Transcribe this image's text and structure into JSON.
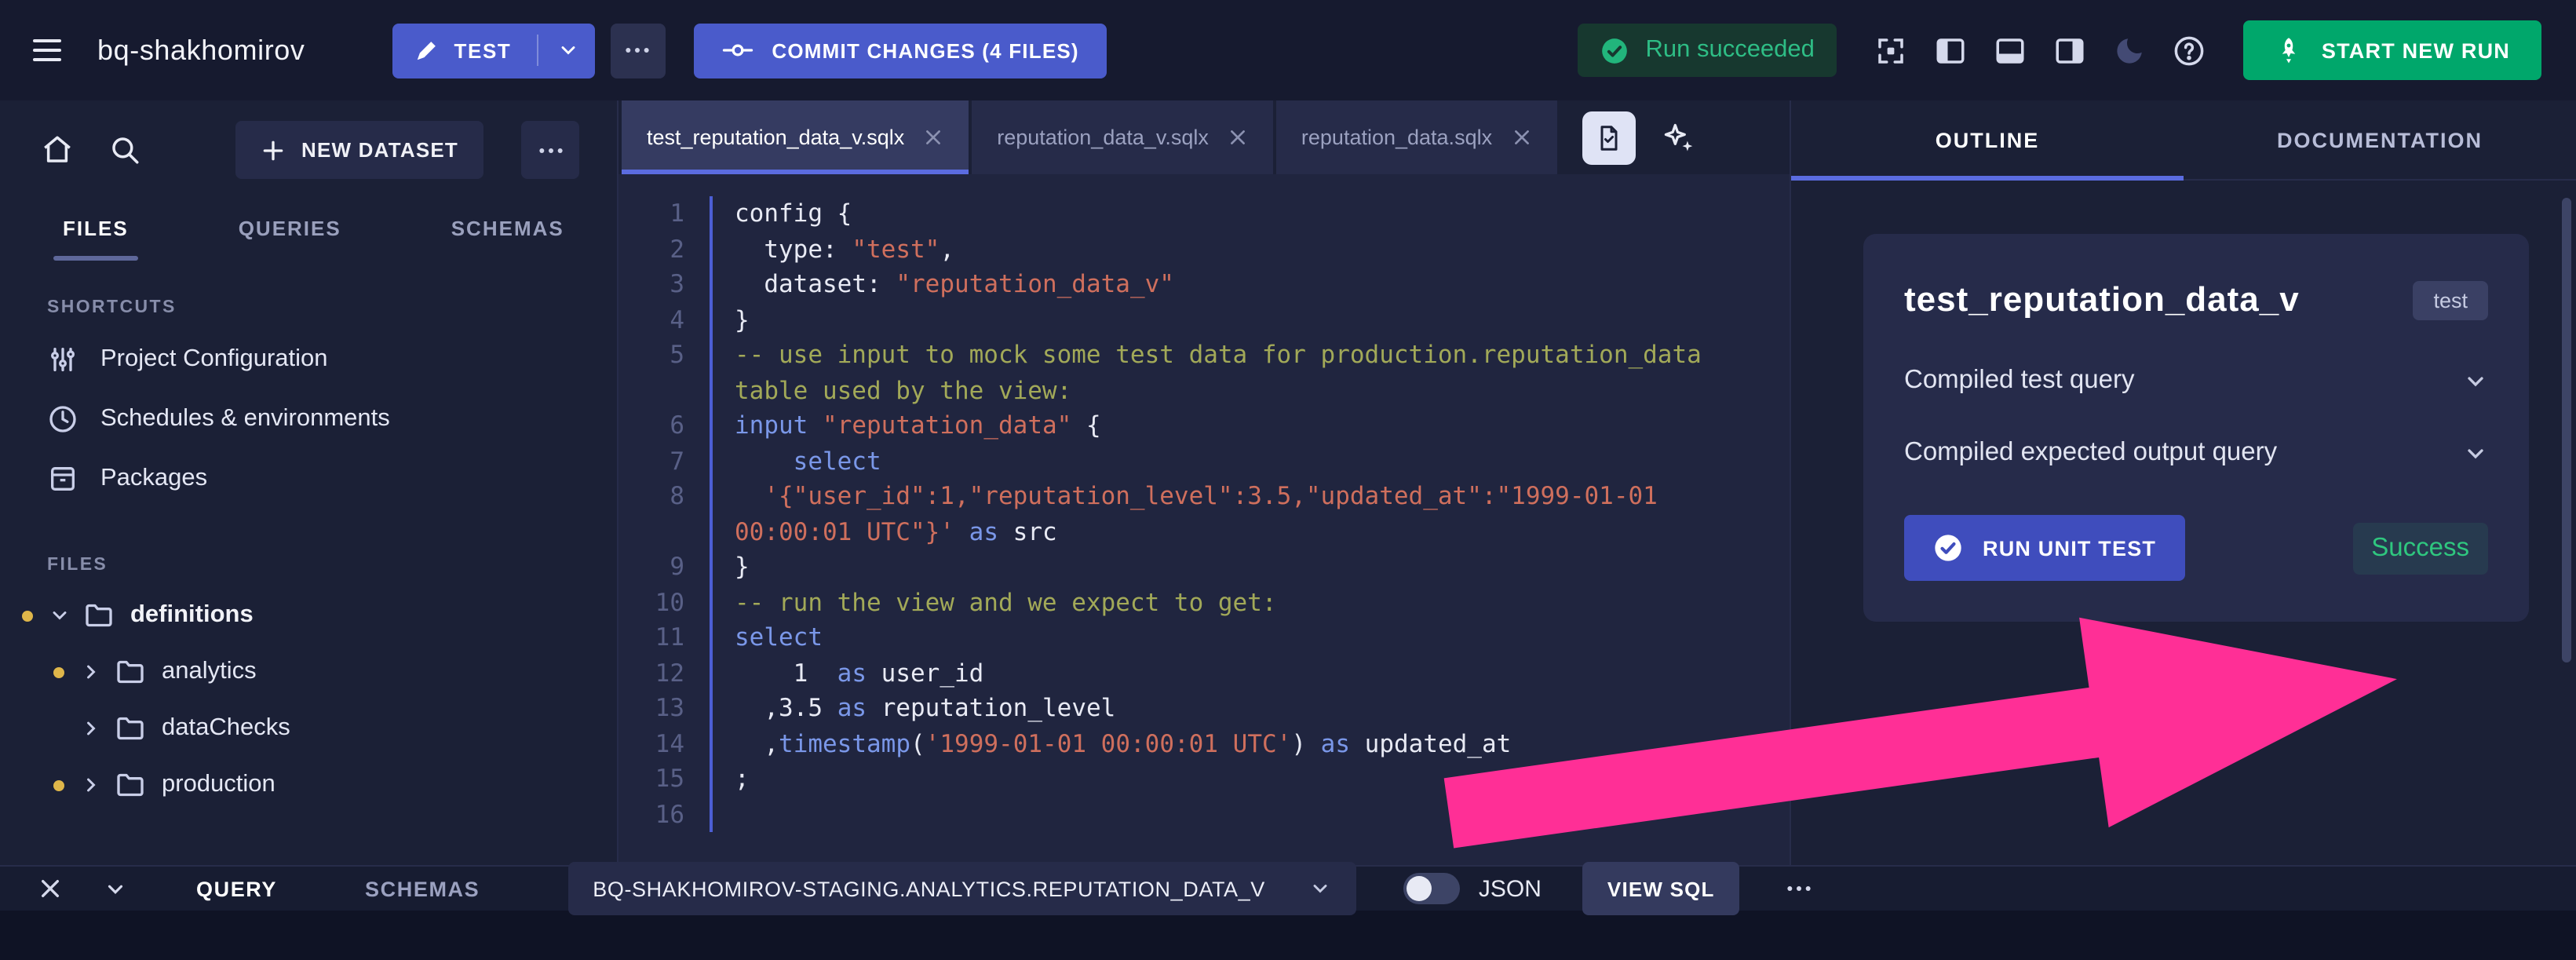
{
  "colors": {
    "accent_blue": "#4a5bcb",
    "run_green": "#00a76b",
    "success_green": "#2fc77f",
    "arrow_pink": "#ff2f96",
    "code_keyword": "#7a97e8",
    "code_string": "#cf6f5d",
    "code_comment": "#a2a958",
    "folder_dot_yellow": "#dfb64a"
  },
  "topbar": {
    "workspace": "bq-shakhomirov",
    "test_label": "TEST",
    "commit_label": "COMMIT CHANGES (4 FILES)",
    "run_status": "Run succeeded",
    "start_run_label": "START NEW RUN"
  },
  "sidebar": {
    "new_dataset_label": "NEW DATASET",
    "tabs": [
      {
        "label": "FILES",
        "active": true
      },
      {
        "label": "QUERIES",
        "active": false
      },
      {
        "label": "SCHEMAS",
        "active": false
      }
    ],
    "shortcuts_title": "SHORTCUTS",
    "shortcuts": [
      {
        "label": "Project Configuration",
        "icon": "sliders-icon"
      },
      {
        "label": "Schedules & environments",
        "icon": "clock-icon"
      },
      {
        "label": "Packages",
        "icon": "package-icon"
      }
    ],
    "files_title": "FILES",
    "tree": [
      {
        "label": "definitions",
        "expanded": true,
        "dot": true
      },
      {
        "label": "analytics",
        "expanded": false,
        "dot": true
      },
      {
        "label": "dataChecks",
        "expanded": false,
        "dot": false
      },
      {
        "label": "production",
        "expanded": false,
        "dot": true
      }
    ]
  },
  "editor": {
    "tabs": [
      {
        "label": "test_reputation_data_v.sqlx",
        "active": true
      },
      {
        "label": "reputation_data_v.sqlx",
        "active": false
      },
      {
        "label": "reputation_data.sqlx",
        "active": false
      }
    ],
    "lines": [
      {
        "n": 1,
        "tokens": [
          {
            "c": "pl",
            "t": "config {"
          }
        ]
      },
      {
        "n": 2,
        "tokens": [
          {
            "c": "pl",
            "t": "  type: "
          },
          {
            "c": "str",
            "t": "\"test\""
          },
          {
            "c": "pl",
            "t": ","
          }
        ]
      },
      {
        "n": 3,
        "tokens": [
          {
            "c": "pl",
            "t": "  dataset: "
          },
          {
            "c": "str",
            "t": "\"reputation_data_v\""
          }
        ]
      },
      {
        "n": 4,
        "tokens": [
          {
            "c": "pl",
            "t": "}"
          }
        ]
      },
      {
        "n": 5,
        "tokens": [
          {
            "c": "com",
            "t": "-- use input to mock some test data for production.reputation_data table used by the view:"
          }
        ]
      },
      {
        "n": 6,
        "tokens": [
          {
            "c": "kw",
            "t": "input"
          },
          {
            "c": "pl",
            "t": " "
          },
          {
            "c": "str",
            "t": "\"reputation_data\""
          },
          {
            "c": "pl",
            "t": " {"
          }
        ]
      },
      {
        "n": 7,
        "tokens": [
          {
            "c": "pl",
            "t": "    "
          },
          {
            "c": "kw",
            "t": "select"
          }
        ]
      },
      {
        "n": 8,
        "tokens": [
          {
            "c": "pl",
            "t": "  "
          },
          {
            "c": "str",
            "t": "'{\"user_id\":1,\"reputation_level\":3.5,\"updated_at\":\"1999-01-01 00:00:01 UTC\"}'"
          },
          {
            "c": "pl",
            "t": " "
          },
          {
            "c": "kw",
            "t": "as"
          },
          {
            "c": "pl",
            "t": " src"
          }
        ]
      },
      {
        "n": 9,
        "tokens": [
          {
            "c": "pl",
            "t": "}"
          }
        ]
      },
      {
        "n": 10,
        "tokens": [
          {
            "c": "com",
            "t": "-- run the view and we expect to get:"
          }
        ]
      },
      {
        "n": 11,
        "tokens": [
          {
            "c": "kw",
            "t": "select"
          }
        ]
      },
      {
        "n": 12,
        "tokens": [
          {
            "c": "pl",
            "t": "    1  "
          },
          {
            "c": "kw",
            "t": "as"
          },
          {
            "c": "pl",
            "t": " user_id"
          }
        ]
      },
      {
        "n": 13,
        "tokens": [
          {
            "c": "pl",
            "t": "  ,3.5 "
          },
          {
            "c": "kw",
            "t": "as"
          },
          {
            "c": "pl",
            "t": " reputation_level"
          }
        ]
      },
      {
        "n": 14,
        "tokens": [
          {
            "c": "pl",
            "t": "  ,"
          },
          {
            "c": "kw",
            "t": "timestamp"
          },
          {
            "c": "pl",
            "t": "("
          },
          {
            "c": "str",
            "t": "'1999-01-01 00:00:01 UTC'"
          },
          {
            "c": "pl",
            "t": ") "
          },
          {
            "c": "kw",
            "t": "as"
          },
          {
            "c": "pl",
            "t": " updated_at"
          }
        ]
      },
      {
        "n": 15,
        "tokens": [
          {
            "c": "pl",
            "t": ";"
          }
        ]
      },
      {
        "n": 16,
        "tokens": [
          {
            "c": "pl",
            "t": ""
          }
        ]
      }
    ]
  },
  "outline": {
    "tabs": [
      {
        "label": "OUTLINE",
        "active": true
      },
      {
        "label": "DOCUMENTATION",
        "active": false
      }
    ],
    "title": "test_reputation_data_v",
    "badge": "test",
    "sections": [
      {
        "label": "Compiled test query"
      },
      {
        "label": "Compiled expected output query"
      }
    ],
    "run_button_label": "RUN UNIT TEST",
    "result": "Success"
  },
  "bottombar": {
    "tabs": [
      {
        "label": "QUERY",
        "active": true
      },
      {
        "label": "SCHEMAS",
        "active": false
      }
    ],
    "dataset": "BQ-SHAKHOMIROV-STAGING.ANALYTICS.REPUTATION_DATA_V",
    "json_label": "JSON",
    "view_sql_label": "VIEW SQL"
  }
}
